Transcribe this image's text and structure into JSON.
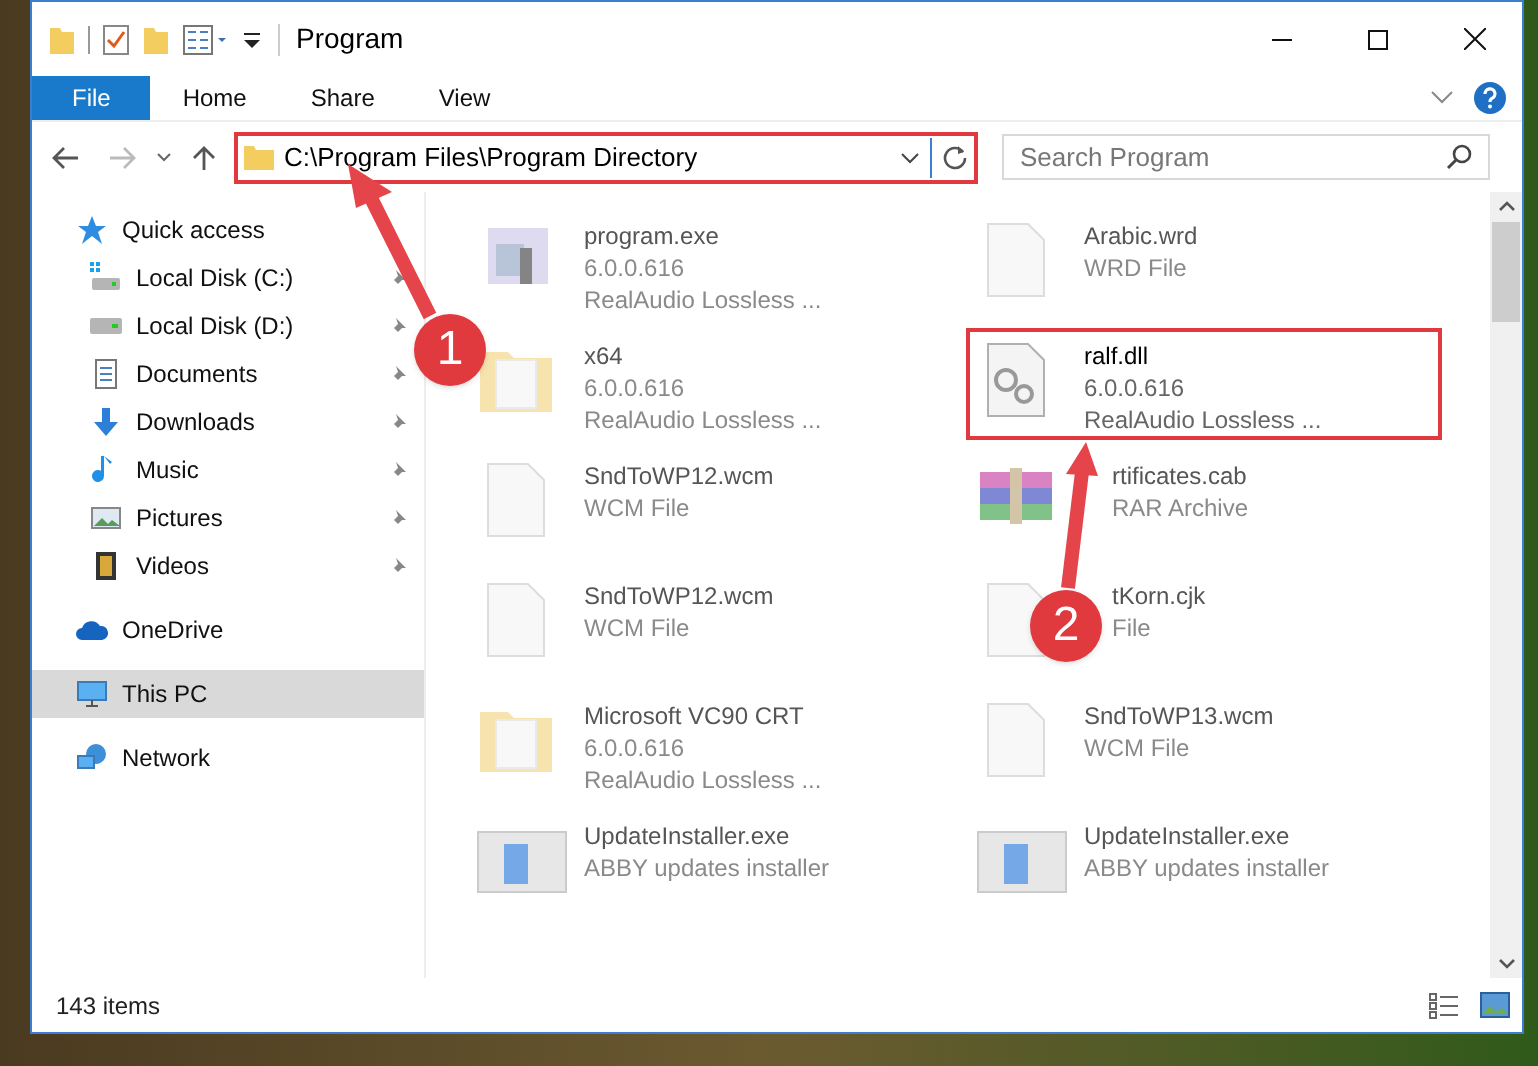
{
  "window": {
    "title": "Program"
  },
  "ribbon_tabs": [
    {
      "label": "File",
      "selected": true
    },
    {
      "label": "Home",
      "selected": false
    },
    {
      "label": "Share",
      "selected": false
    },
    {
      "label": "View",
      "selected": false
    }
  ],
  "address_bar": {
    "path": "C:\\Program Files\\Program Directory",
    "highlighted": true
  },
  "search": {
    "placeholder": "Search Program"
  },
  "sidebar": {
    "items": [
      {
        "label": "Quick access",
        "kind": "star",
        "pinned": false,
        "selected": false,
        "children": [
          {
            "label": "Local Disk (C:)",
            "kind": "disk-windows",
            "pinned": true,
            "selected": false
          },
          {
            "label": "Local Disk (D:)",
            "kind": "disk",
            "pinned": true,
            "selected": false
          },
          {
            "label": "Documents",
            "kind": "document",
            "pinned": true,
            "selected": false
          },
          {
            "label": "Downloads",
            "kind": "download",
            "pinned": true,
            "selected": false
          },
          {
            "label": "Music",
            "kind": "music",
            "pinned": true,
            "selected": false
          },
          {
            "label": "Pictures",
            "kind": "picture",
            "pinned": true,
            "selected": false
          },
          {
            "label": "Videos",
            "kind": "video",
            "pinned": true,
            "selected": false
          }
        ]
      },
      {
        "label": "OneDrive",
        "kind": "cloud",
        "pinned": false,
        "selected": false
      },
      {
        "label": "This PC",
        "kind": "pc",
        "pinned": false,
        "selected": true
      },
      {
        "label": "Network",
        "kind": "network",
        "pinned": false,
        "selected": false
      }
    ]
  },
  "files": [
    {
      "kind": "exe",
      "name": "program.exe",
      "lines": [
        "6.0.0.616",
        "RealAudio Lossless ..."
      ],
      "blurred": true,
      "highlighted": false
    },
    {
      "kind": "blank",
      "name": "Arabic.wrd",
      "lines": [
        "WRD File"
      ],
      "blurred": true,
      "highlighted": false
    },
    {
      "kind": "folder",
      "name": "x64",
      "lines": [
        "6.0.0.616",
        "RealAudio Lossless ..."
      ],
      "blurred": true,
      "highlighted": false
    },
    {
      "kind": "gear",
      "name": "ralf.dll",
      "lines": [
        "6.0.0.616",
        "RealAudio Lossless ..."
      ],
      "blurred": false,
      "highlighted": true
    },
    {
      "kind": "blank",
      "name": "SndToWP12.wcm",
      "lines": [
        "WCM File"
      ],
      "blurred": true,
      "highlighted": false
    },
    {
      "kind": "archive",
      "name": "rtificates.cab",
      "lines": [
        "RAR Archive"
      ],
      "blurred": true,
      "highlighted": false,
      "covered_by_annotation": true
    },
    {
      "kind": "blank",
      "name": "SndToWP12.wcm",
      "lines": [
        "WCM File"
      ],
      "blurred": true,
      "highlighted": false
    },
    {
      "kind": "blank",
      "name": "tKorn.cjk",
      "lines": [
        "File"
      ],
      "blurred": true,
      "highlighted": false,
      "covered_by_annotation": true
    },
    {
      "kind": "folder",
      "name": "Microsoft VC90 CRT",
      "lines": [
        "6.0.0.616",
        "RealAudio Lossless ..."
      ],
      "blurred": true,
      "highlighted": false
    },
    {
      "kind": "blank",
      "name": "SndToWP13.wcm",
      "lines": [
        "WCM File"
      ],
      "blurred": true,
      "highlighted": false
    },
    {
      "kind": "installer",
      "name": "UpdateInstaller.exe",
      "lines": [
        "ABBY updates installer"
      ],
      "blurred": true,
      "highlighted": false
    },
    {
      "kind": "installer",
      "name": "UpdateInstaller.exe",
      "lines": [
        "ABBY updates installer"
      ],
      "blurred": true,
      "highlighted": false
    }
  ],
  "status_bar": {
    "item_count": "143 items"
  },
  "annotations": [
    {
      "label": "1"
    },
    {
      "label": "2"
    }
  ]
}
